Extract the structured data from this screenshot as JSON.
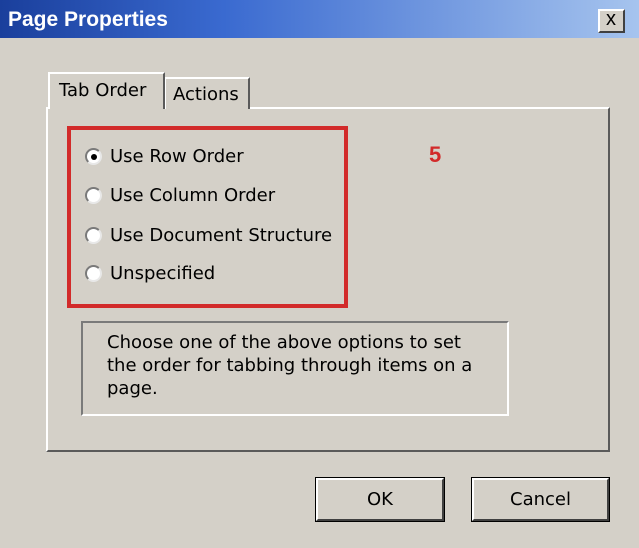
{
  "window": {
    "title": "Page Properties",
    "close_glyph": "x"
  },
  "tabs": [
    {
      "label": "Tab Order",
      "active": true
    },
    {
      "label": "Actions",
      "active": false
    }
  ],
  "tab_order": {
    "options": [
      {
        "label": "Use Row Order",
        "checked": true
      },
      {
        "label": "Use Column Order",
        "checked": false
      },
      {
        "label": "Use Document Structure",
        "checked": false
      },
      {
        "label": "Unspecified",
        "checked": false
      }
    ],
    "description": "Choose one of the above options to set the order for tabbing through items on a page."
  },
  "annotation": {
    "step_number": "5",
    "color": "#d22a2a"
  },
  "buttons": {
    "ok": "OK",
    "cancel": "Cancel"
  },
  "colors": {
    "title_start": "#1a3f9c",
    "title_end": "#a6c4ee",
    "dialog_bg": "#d4d0c8"
  }
}
